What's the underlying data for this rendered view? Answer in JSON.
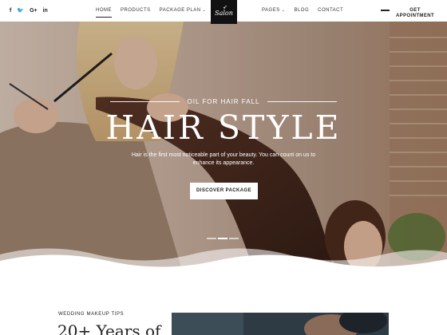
{
  "header": {
    "social": [
      {
        "icon": "facebook-icon",
        "glyph": "f"
      },
      {
        "icon": "twitter-icon",
        "glyph": "🐦"
      },
      {
        "icon": "google-plus-icon",
        "glyph": "G+"
      },
      {
        "icon": "linkedin-icon",
        "glyph": "in"
      }
    ],
    "nav_left": [
      {
        "label": "HOME",
        "active": true,
        "dropdown": false
      },
      {
        "label": "PRODUCTS",
        "active": false,
        "dropdown": false
      },
      {
        "label": "PACKAGE PLAN",
        "active": false,
        "dropdown": true
      }
    ],
    "logo_text": "Salon",
    "nav_right": [
      {
        "label": "PAGES",
        "active": false,
        "dropdown": true
      },
      {
        "label": "BLOG",
        "active": false,
        "dropdown": false
      },
      {
        "label": "CONTACT",
        "active": false,
        "dropdown": false
      }
    ],
    "cta_line1": "GET",
    "cta_line2": "APPOINTMENT"
  },
  "hero": {
    "subtitle": "OIL FOR HAIR FALL",
    "title": "HAIR STYLE",
    "description": "Hair is the first most noticeable part of your beauty. You can count on us to enhance its appearance.",
    "button_label": "DISCOVER PACKAGE",
    "slides": 3,
    "active_slide": 2
  },
  "section": {
    "kicker": "WEDDING MAKEUP TIPS",
    "heading": "20+ Years of"
  },
  "colors": {
    "header_bg": "#ffffff",
    "logo_bg": "#111111",
    "hero_text": "#ffffff",
    "button_bg": "#ffffff",
    "text_dark": "#222222"
  }
}
